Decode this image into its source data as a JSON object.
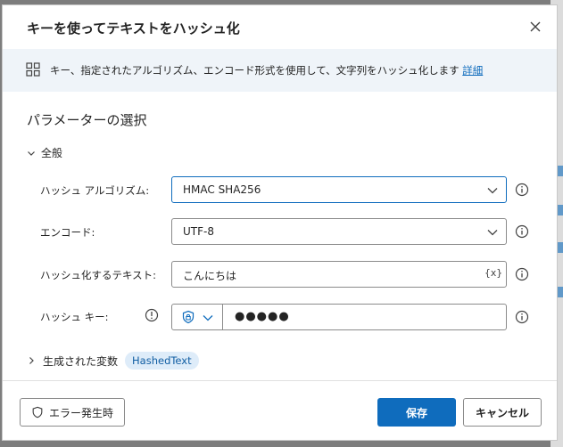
{
  "dialog": {
    "title": "キーを使ってテキストをハッシュ化",
    "description": "キー、指定されたアルゴリズム、エンコード形式を使用して、文字列をハッシュ化します",
    "details_link": "詳細",
    "section_title": "パラメーターの選択",
    "group_general": "全般",
    "fields": {
      "algorithm": {
        "label": "ハッシュ アルゴリズム:",
        "value": "HMAC SHA256"
      },
      "encoding": {
        "label": "エンコード:",
        "value": "UTF-8"
      },
      "text": {
        "label": "ハッシュ化するテキスト:",
        "value": "こんにちは",
        "var_button": "{x}"
      },
      "key": {
        "label": "ハッシュ キー:",
        "value": "●●●●●"
      }
    },
    "variables": {
      "label": "生成された変数",
      "chip": "HashedText"
    },
    "footer": {
      "error_button": "エラー発生時",
      "save_button": "保存",
      "cancel_button": "キャンセル"
    }
  },
  "colors": {
    "accent": "#0f6cbd",
    "banner_bg": "#eff4f9",
    "chip_bg": "#deecf9"
  }
}
